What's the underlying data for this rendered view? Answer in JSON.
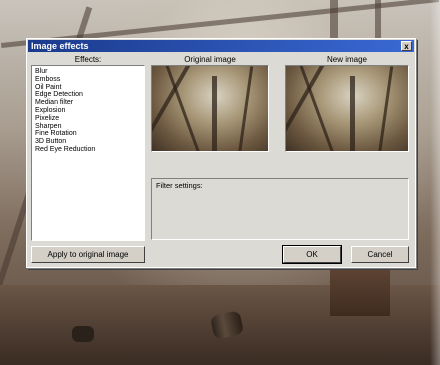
{
  "dialog": {
    "title": "Image effects",
    "close_glyph": "x",
    "effects_label": "Effects:",
    "original_label": "Original image",
    "new_label": "New image",
    "filter_settings_label": "Filter settings:",
    "effects": [
      "Blur",
      "Emboss",
      "Oil Paint",
      "Edge Detection",
      "Median filter",
      "Explosion",
      "Pixelize",
      "Sharpen",
      "Fine Rotation",
      "3D Button",
      "Red Eye Reduction"
    ],
    "apply_button": "Apply to original image",
    "ok_button": "OK",
    "cancel_button": "Cancel"
  },
  "icons": {
    "close": "close-icon"
  }
}
